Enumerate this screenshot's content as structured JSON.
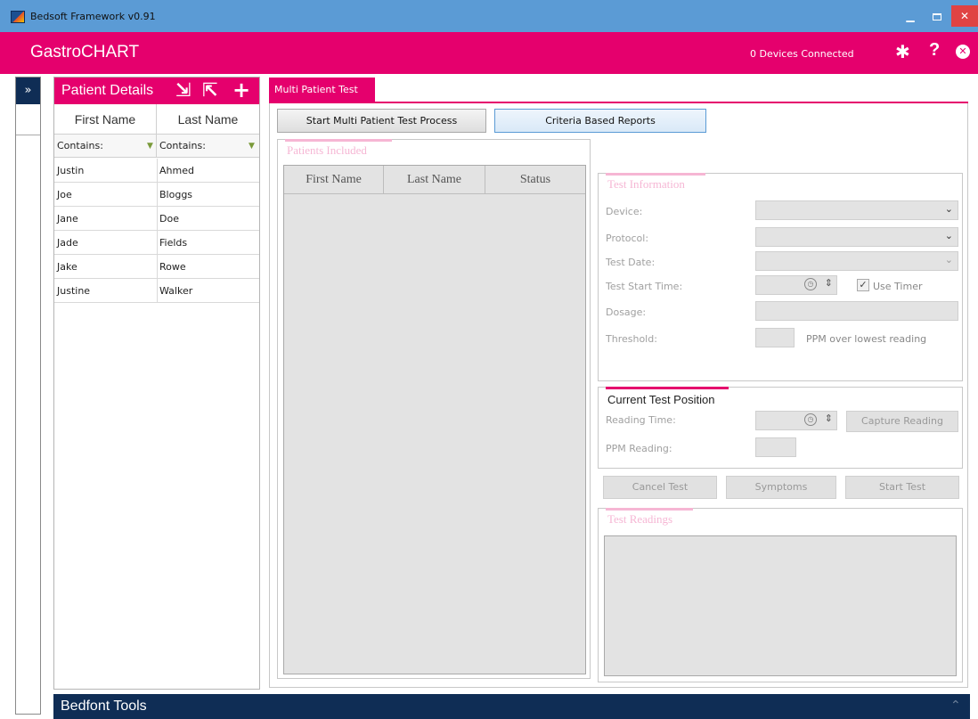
{
  "window": {
    "title": "Bedsoft Framework v0.91"
  },
  "header": {
    "brand": "GastroCHART",
    "devices_status": "0 Devices Connected"
  },
  "icons": {
    "strip_toggle": "»",
    "settings": "✱",
    "help": "?",
    "close": "✕",
    "import": "⇲",
    "export": "⇱",
    "add": "+"
  },
  "patient_details": {
    "title": "Patient Details",
    "columns": [
      "First Name",
      "Last Name"
    ],
    "filter_label": "Contains:",
    "patients": [
      {
        "first": "Justin",
        "last": "Ahmed"
      },
      {
        "first": "Joe",
        "last": "Bloggs"
      },
      {
        "first": "Jane",
        "last": "Doe"
      },
      {
        "first": "Jade",
        "last": "Fields"
      },
      {
        "first": "Jake",
        "last": "Rowe"
      },
      {
        "first": "Justine",
        "last": "Walker"
      }
    ]
  },
  "multi_test": {
    "tab_label": "Multi Patient Test",
    "start_button": "Start Multi Patient Test Process",
    "criteria_button": "Criteria Based Reports",
    "patients_included": {
      "title": "Patients Included",
      "columns": [
        "First Name",
        "Last Name",
        "Status"
      ]
    },
    "test_information": {
      "title": "Test Information",
      "device_label": "Device:",
      "protocol_label": "Protocol:",
      "test_date_label": "Test Date:",
      "start_time_label": "Test Start Time:",
      "use_timer_label": "Use Timer",
      "use_timer_checked": true,
      "dosage_label": "Dosage:",
      "threshold_label": "Threshold:",
      "threshold_suffix": "PPM over lowest reading"
    },
    "current_position": {
      "title": "Current Test Position",
      "reading_time_label": "Reading Time:",
      "capture_button": "Capture Reading",
      "ppm_label": "PPM Reading:"
    },
    "actions": {
      "cancel": "Cancel Test",
      "symptoms": "Symptoms",
      "start": "Start Test"
    },
    "test_readings": {
      "title": "Test Readings"
    }
  },
  "tools": {
    "title": "Bedfont Tools"
  }
}
